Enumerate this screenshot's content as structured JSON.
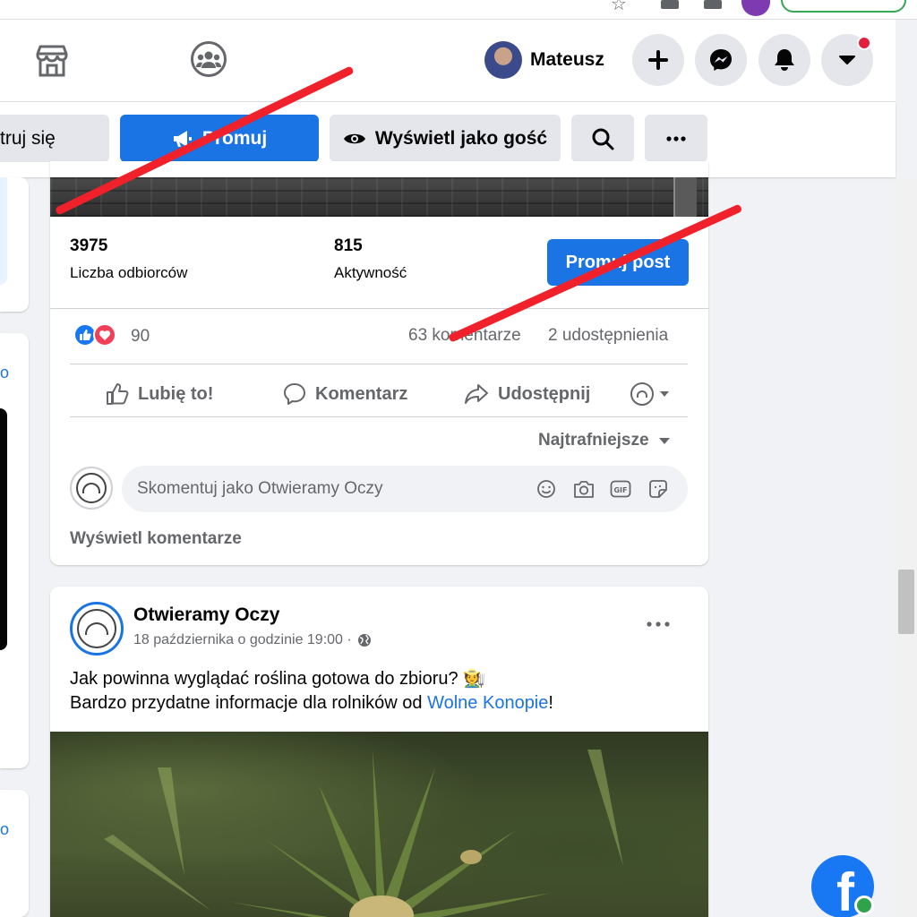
{
  "topbar": {
    "user_name": "Mateusz"
  },
  "pagebar": {
    "edit_label": "truj się",
    "promote_label": "Promuj",
    "view_as_label": "Wyświetl jako gość"
  },
  "post1": {
    "reach_value": "3975",
    "reach_label": "Liczba odbiorców",
    "engagement_value": "815",
    "engagement_label": "Aktywność",
    "boost_label": "Promuj post",
    "reactions_count": "90",
    "comments_count": "63 komentarze",
    "shares_count": "2 udostępnienia",
    "actions": {
      "like": "Lubię to!",
      "comment": "Komentarz",
      "share": "Udostępnij"
    },
    "sort_label": "Najtrafniejsze",
    "comment_placeholder": "Skomentuj jako Otwieramy Oczy",
    "view_comments": "Wyświetl komentarze"
  },
  "post2": {
    "author": "Otwieramy Oczy",
    "timestamp": "18 października o godzinie 19:00 ·",
    "text_line1": "Jak powinna wyglądać roślina gotowa do zbioru? 🧑‍🌾",
    "text_line2_prefix": "Bardzo przydatne informacje dla rolników od ",
    "text_line2_link": "Wolne Konopie",
    "text_line2_suffix": "!"
  },
  "colors": {
    "accent": "#1b74e4",
    "overlay_line": "#f0212b",
    "notification": "#e41e3f"
  },
  "icons": [
    "store-icon",
    "groups-icon",
    "plus-icon",
    "messenger-icon",
    "bell-icon",
    "caret-down-icon",
    "megaphone-icon",
    "eye-icon",
    "search-icon",
    "more-icon",
    "like-icon",
    "comment-icon",
    "share-icon",
    "globe-icon",
    "smiley-icon",
    "camera-icon",
    "gif-icon",
    "sticker-icon",
    "facebook-logo-icon"
  ]
}
